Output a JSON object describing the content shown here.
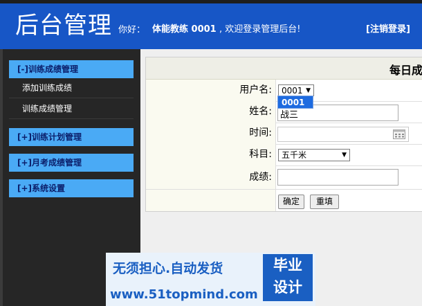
{
  "header": {
    "title": "后台管理",
    "hello": "你好：",
    "user": "体能教练 0001",
    "welcome": ", 欢迎登录管理后台!",
    "logout": "[注销登录]"
  },
  "sidebar": {
    "menus": [
      {
        "label": "[-]训练成绩管理",
        "children": [
          "添加训练成绩",
          "训练成绩管理"
        ]
      },
      {
        "label": "[+]训练计划管理"
      },
      {
        "label": "[+]月考成绩管理"
      },
      {
        "label": "[+]系统设置"
      }
    ]
  },
  "form": {
    "caption": "每日成",
    "username_label": "用户名:",
    "username_value": "0001",
    "username_option": "0001",
    "name_label": "姓名:",
    "name_value": "战三",
    "time_label": "时间:",
    "subject_label": "科目:",
    "subject_value": "五千米",
    "score_label": "成绩:",
    "submit": "确定",
    "reset": "重填"
  },
  "watermark": {
    "line1": "无须担心.自动发货",
    "line2": "www.51topmind.com",
    "logo_top": "毕业",
    "logo_bottom": "设计"
  }
}
